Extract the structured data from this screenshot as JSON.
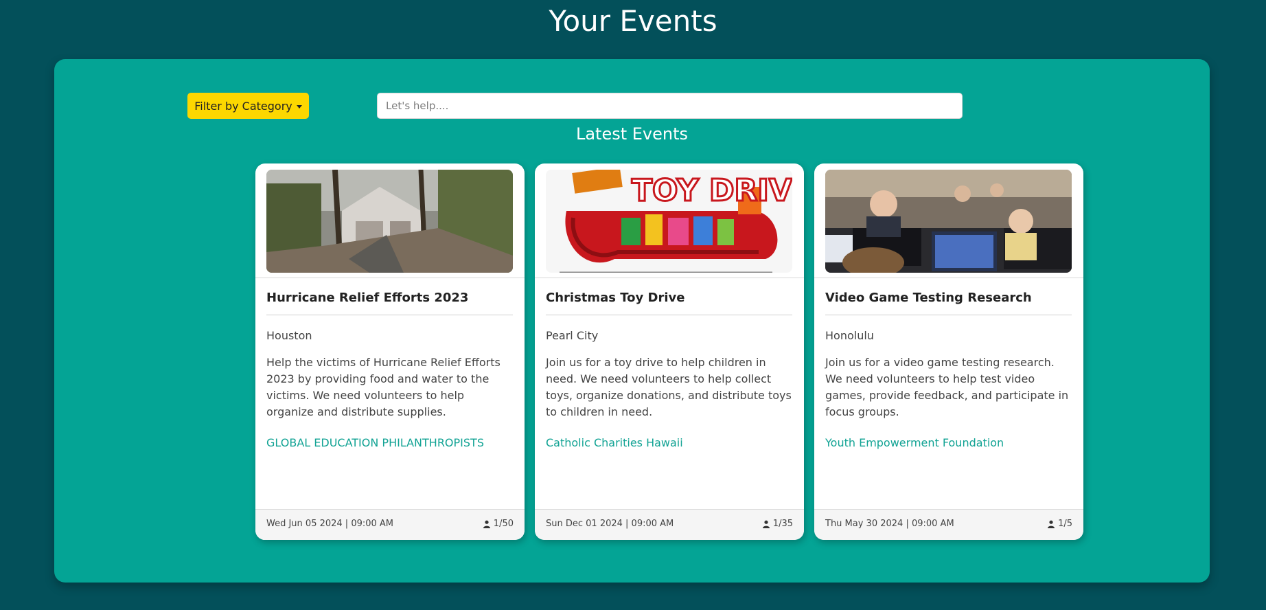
{
  "header": {
    "title": "Your Events"
  },
  "toolbar": {
    "filter_label": "Filter by Category",
    "search_placeholder": "Let's help...."
  },
  "section": {
    "title": "Latest Events"
  },
  "events": [
    {
      "title": "Hurricane Relief Efforts 2023",
      "city": "Houston",
      "description": "Help the victims of Hurricane Relief Efforts 2023 by providing food and water to the victims. We need volunteers to help organize and distribute supplies.",
      "organization": "GLOBAL EDUCATION PHILANTHROPISTS",
      "date": "Wed Jun 05 2024 | 09:00 AM",
      "attendees": "1/50"
    },
    {
      "title": "Christmas Toy Drive",
      "city": "Pearl City",
      "description": "Join us for a toy drive to help children in need. We need volunteers to help collect toys, organize donations, and distribute toys to children in need.",
      "organization": "Catholic Charities Hawaii",
      "date": "Sun Dec 01 2024 | 09:00 AM",
      "attendees": "1/35"
    },
    {
      "title": "Video Game Testing Research",
      "city": "Honolulu",
      "description": "Join us for a video game testing research. We need volunteers to help test video games, provide feedback, and participate in focus groups.",
      "organization": "Youth Empowerment Foundation",
      "date": "Thu May 30 2024 | 09:00 AM",
      "attendees": "1/5"
    }
  ],
  "toy_drive_logo_text": "TOY DRIVE",
  "colors": {
    "background": "#03505a",
    "panel": "#04a495",
    "filter_button": "#fcd700",
    "link": "#12a394"
  },
  "icons": {
    "attendee": "person-icon"
  }
}
